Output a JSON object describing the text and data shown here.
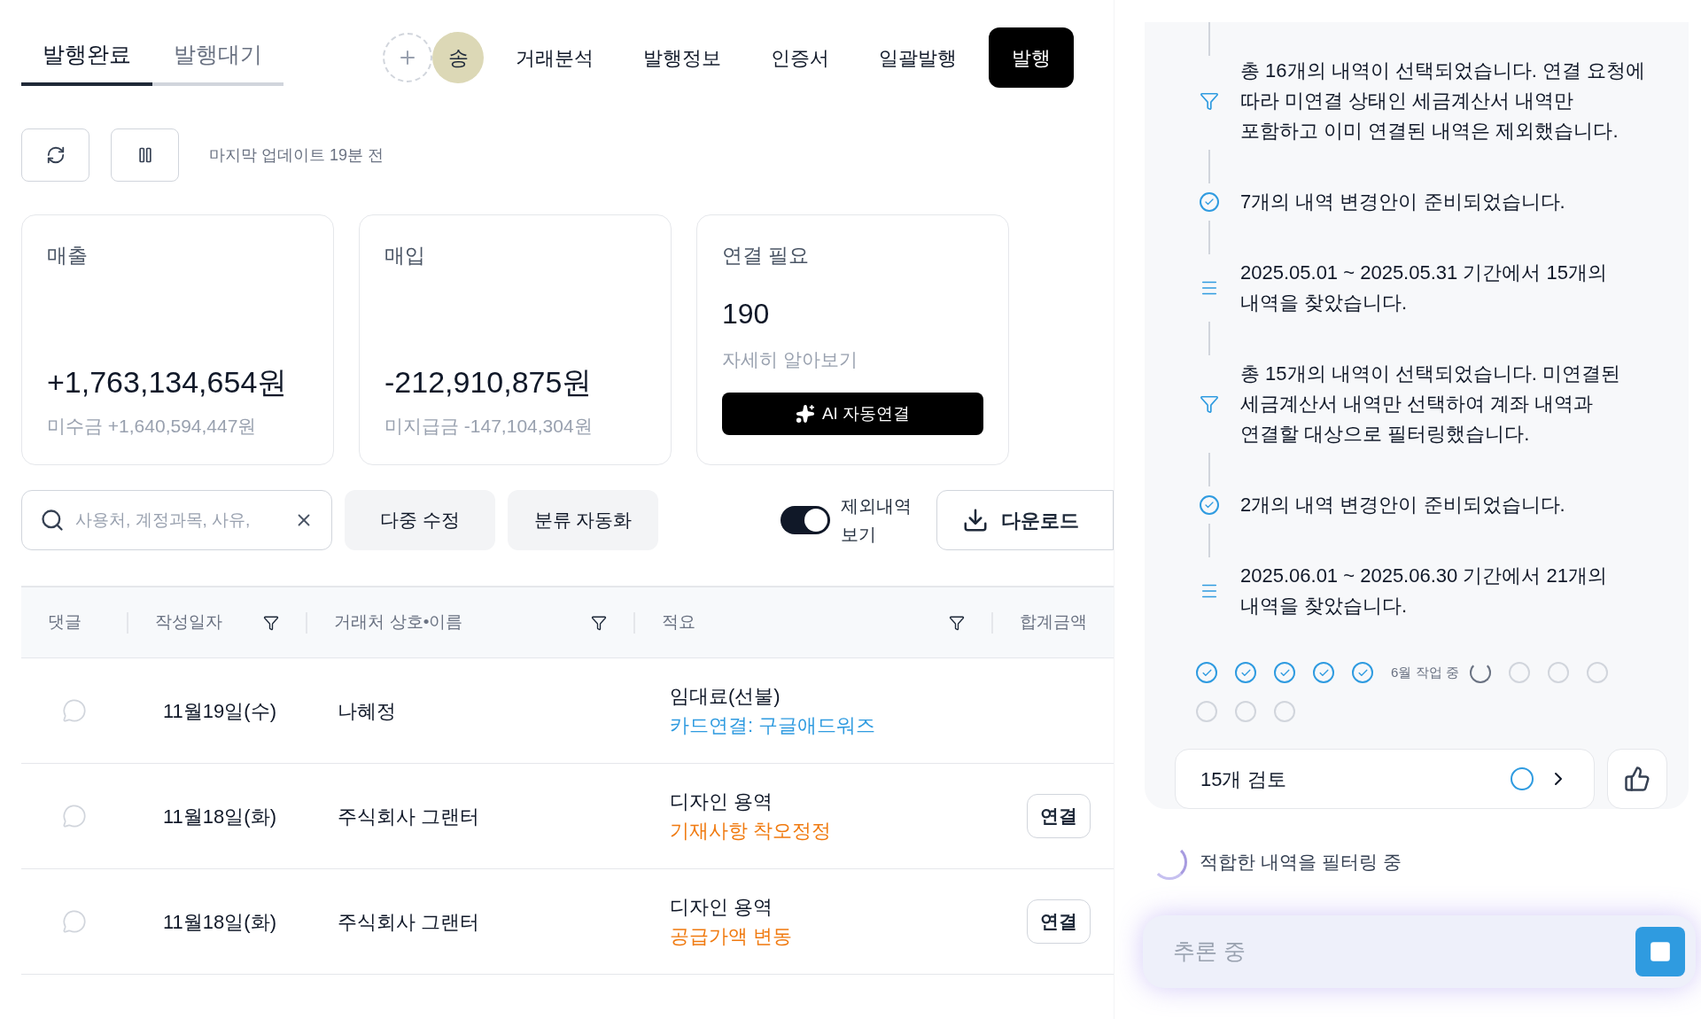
{
  "tabs": [
    {
      "label": "발행완료",
      "selected": true
    },
    {
      "label": "발행대기",
      "selected": false
    }
  ],
  "avatar": {
    "label": "송"
  },
  "nav": [
    "거래분석",
    "발행정보",
    "인증서",
    "일괄발행"
  ],
  "primary_button": "발행",
  "last_update": "마지막 업데이트 19분 전",
  "cards": [
    {
      "kind": "amount",
      "title": "매출",
      "amount": "+1,763,134,654원",
      "sub": "미수금 +1,640,594,447원"
    },
    {
      "kind": "amount",
      "title": "매입",
      "amount": "-212,910,875원",
      "sub": "미지급금 -147,104,304원"
    },
    {
      "kind": "link",
      "title": "연결 필요",
      "count": "190",
      "link": "자세히 알아보기",
      "action": "AI 자동연결"
    }
  ],
  "search": {
    "placeholder": "사용처, 계정과목, 사유,"
  },
  "buttons": [
    "다중 수정",
    "분류 자동화"
  ],
  "exclude_toggle": {
    "label": "제외내역 보기",
    "on": true
  },
  "download": "다운로드",
  "table": {
    "columns": [
      {
        "label": "댓글",
        "filter": false
      },
      {
        "label": "작성일자",
        "filter": true
      },
      {
        "label": "거래처 상호•이름",
        "filter": true
      },
      {
        "label": "적요",
        "filter": true
      },
      {
        "label": "합계금액",
        "filter": false
      }
    ],
    "rows": [
      {
        "date": "11월19일(수)",
        "party": "나혜정",
        "summary": "임대료(선불)",
        "note": "카드연결: 구글애드워즈",
        "color": "#2f9be0"
      },
      {
        "date": "11월18일(화)",
        "party": "주식회사 그랜터",
        "summary": "디자인 용역",
        "note": "기재사항 착오정정",
        "color": "#f07a10",
        "action": "연결"
      },
      {
        "date": "11월18일(화)",
        "party": "주식회사 그랜터",
        "summary": "디자인 용역",
        "note": "공급가액 변동",
        "color": "#f07a10",
        "action": "연결"
      }
    ]
  },
  "timeline": [
    {
      "kind": "filter",
      "text": "총 16개의 내역이 선택되었습니다. 연결 요청에 따라 미연결 상태인 세금계산서 내역만 포함하고 이미 연결된 내역은 제외했습니다."
    },
    {
      "kind": "check",
      "text": "7개의 내역 변경안이 준비되었습니다."
    },
    {
      "kind": "list",
      "text": "2025.05.01 ~ 2025.05.31 기간에서 15개의 내역을 찾았습니다."
    },
    {
      "kind": "filter",
      "text": "총 15개의 내역이 선택되었습니다. 미연결된 세금계산서 내역만 선택하여 계좌 내역과 연결할 대상으로 필터링했습니다."
    },
    {
      "kind": "check",
      "text": "2개의 내역 변경안이 준비되었습니다."
    },
    {
      "kind": "list",
      "text": "2025.06.01 ~ 2025.06.30 기간에서 21개의 내역을 찾았습니다."
    }
  ],
  "progress": [
    {
      "kind": "done"
    },
    {
      "kind": "done"
    },
    {
      "kind": "done"
    },
    {
      "kind": "done"
    },
    {
      "kind": "done"
    },
    {
      "kind": "active",
      "label": "6월 작업 중"
    },
    {
      "kind": "pending"
    },
    {
      "kind": "pending"
    },
    {
      "kind": "pending"
    },
    {
      "kind": "pending"
    },
    {
      "kind": "pending"
    },
    {
      "kind": "pending"
    }
  ],
  "review": {
    "label": "15개 검토"
  },
  "status": "적합한 내역을 필터링 중",
  "input": {
    "placeholder": "추론 중"
  }
}
